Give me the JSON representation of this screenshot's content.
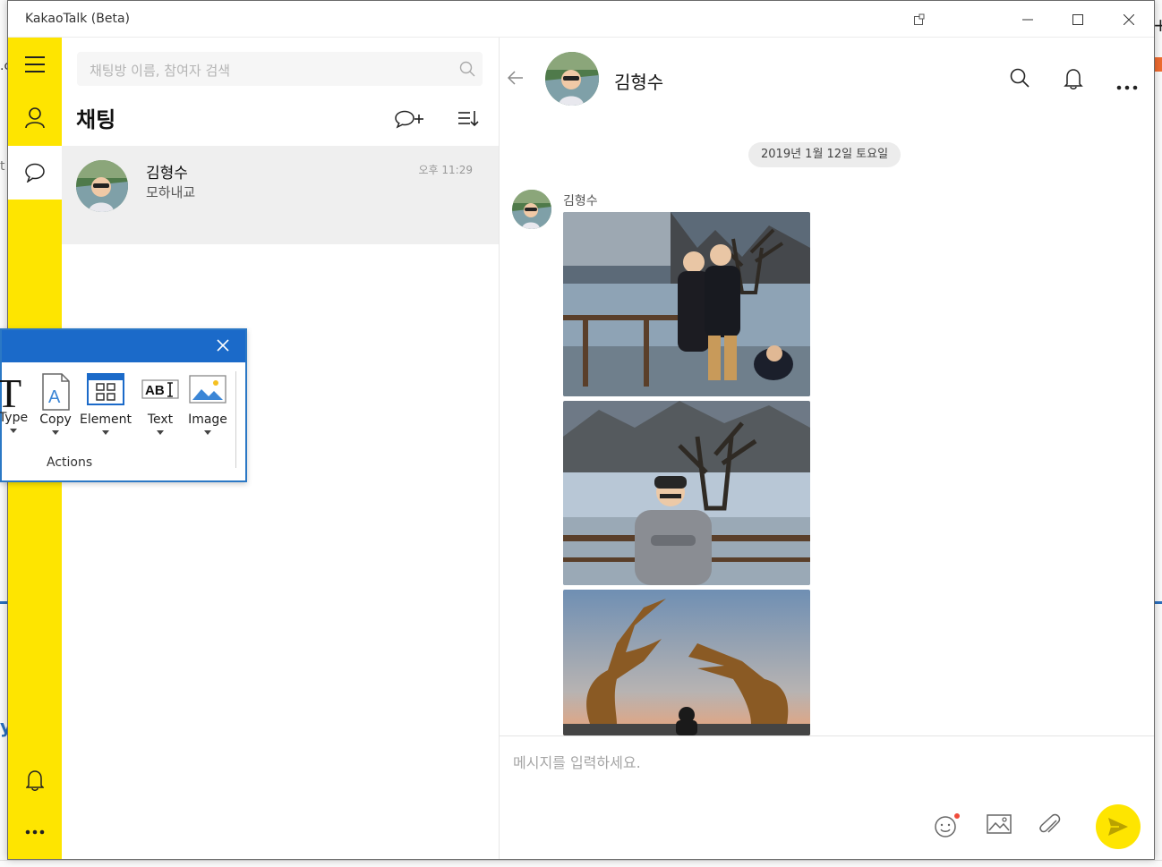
{
  "window": {
    "title": "KakaoTalk (Beta)"
  },
  "sidebar": {
    "items": [
      {
        "name": "menu-icon"
      },
      {
        "name": "friends-icon"
      },
      {
        "name": "chats-icon"
      },
      {
        "name": "notifications-icon"
      },
      {
        "name": "more-icon"
      }
    ]
  },
  "chat_list": {
    "search_placeholder": "채팅방 이름, 참여자 검색",
    "title": "채팅",
    "items": [
      {
        "name": "김형수",
        "last_message": "모하내교",
        "time": "오후 11:29"
      }
    ]
  },
  "conversation": {
    "name": "김형수",
    "date": "2019년 1월 12일 토요일",
    "sender": "김형수",
    "input_placeholder": "메시지를 입력하세요.",
    "notification_dot_color": "#f04b3a"
  },
  "actions_popup": {
    "tools": [
      {
        "label": "Type",
        "icon": "type-icon"
      },
      {
        "label": "Copy",
        "icon": "copy-icon"
      },
      {
        "label": "Element",
        "icon": "element-icon"
      },
      {
        "label": "Text",
        "icon": "text-icon"
      },
      {
        "label": "Image",
        "icon": "image-icon"
      }
    ],
    "group_label": "Actions"
  },
  "colors": {
    "accent": "#fee500",
    "popup_header": "#1b6ac9"
  }
}
